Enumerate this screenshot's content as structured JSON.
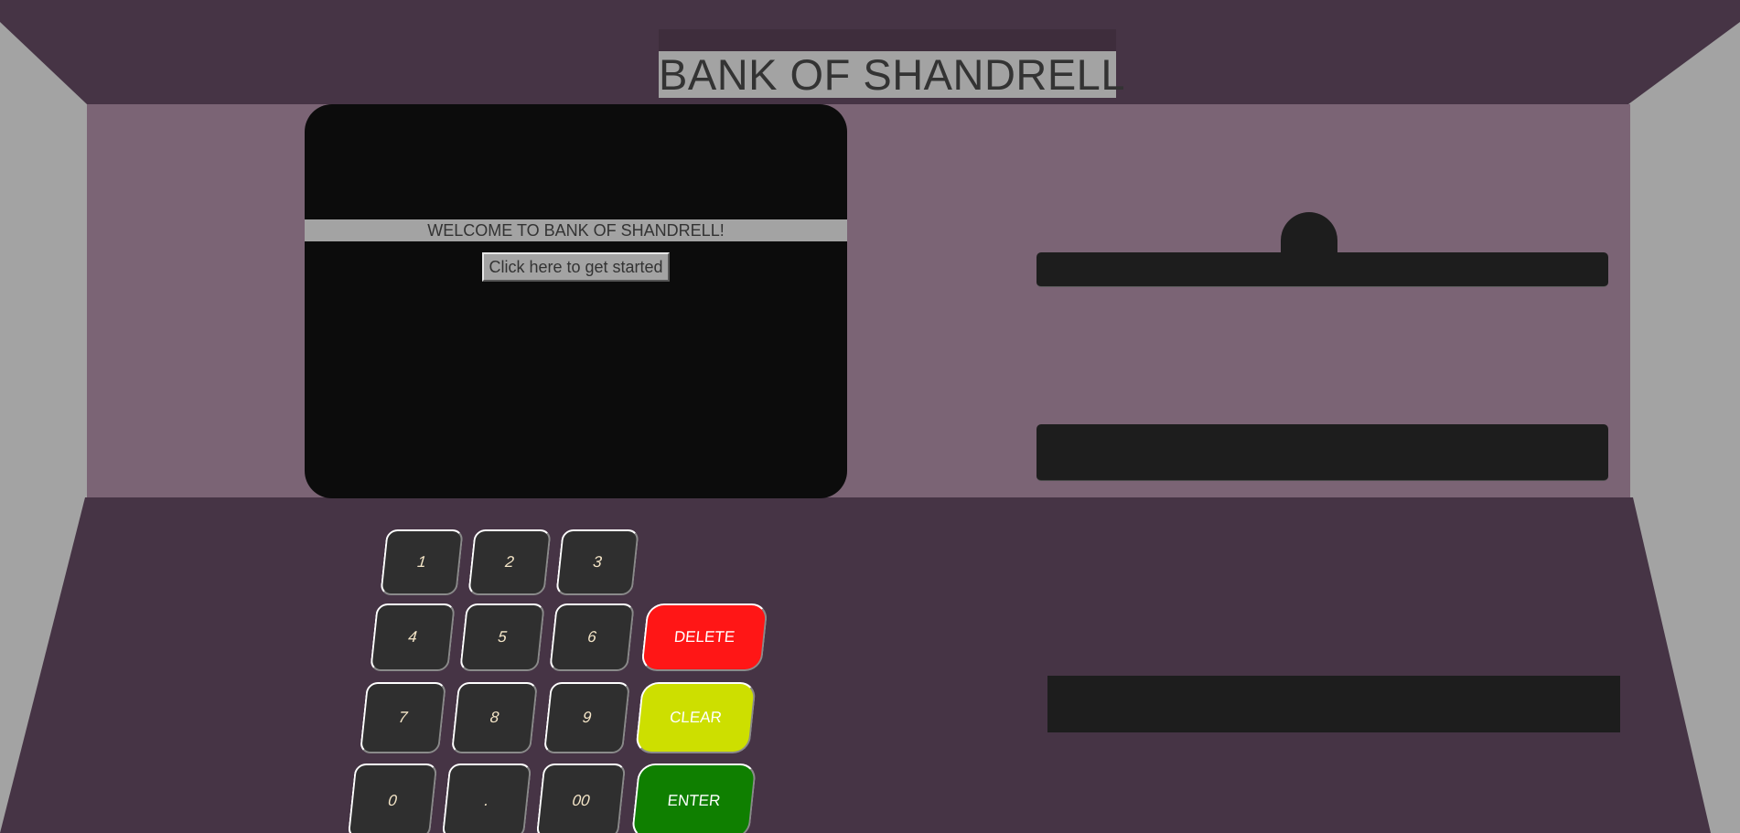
{
  "bank": {
    "name": "BANK OF SHANDRELL"
  },
  "screen": {
    "welcome": "WELCOME TO BANK OF SHANDRELL!",
    "start_button": "Click here to get started"
  },
  "keypad": {
    "k1": "1",
    "k2": "2",
    "k3": "3",
    "k4": "4",
    "k5": "5",
    "k6": "6",
    "k7": "7",
    "k8": "8",
    "k9": "9",
    "k0": "0",
    "kdot": ".",
    "k00": "00",
    "delete": "DELETE",
    "clear": "CLEAR",
    "enter": "ENTER"
  },
  "colors": {
    "frame_top": "#463445",
    "panel": "#7b6475",
    "frame_bottom": "#463445",
    "screen": "#0c0c0c",
    "slot": "#1d1d1d",
    "key": "#2f2f2f",
    "delete": "#ff1616",
    "clear": "#cddf00",
    "enter": "#0f7f00"
  }
}
